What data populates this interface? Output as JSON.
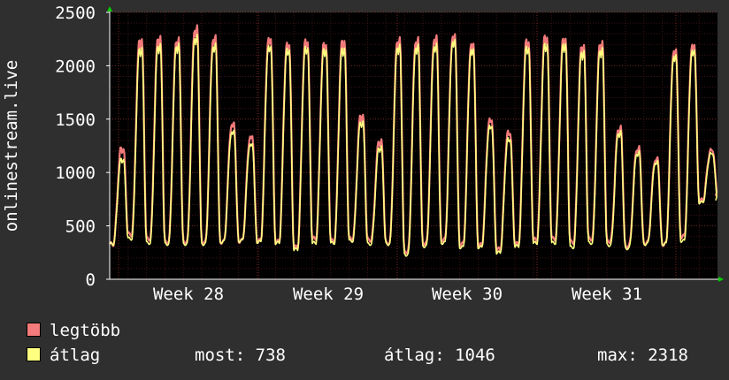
{
  "chart_data": {
    "type": "line",
    "ylabel": "onlinestream.live",
    "ylim": [
      0,
      2500
    ],
    "yticks": [
      0,
      500,
      1000,
      1500,
      2000,
      2500
    ],
    "x_tick_labels": [
      "Week 28",
      "Week 29",
      "Week 30",
      "Week 31"
    ],
    "days": 33,
    "grid": true,
    "background": "#000000",
    "grid_color": "#5a1d1d",
    "series": [
      {
        "name": "legtöbb",
        "color": "#f37b7b",
        "daily_peaks": [
          1230,
          2250,
          2270,
          2250,
          2360,
          2270,
          1460,
          1340,
          2260,
          2210,
          2240,
          2210,
          2240,
          1540,
          1300,
          2250,
          2250,
          2270,
          2290,
          2210,
          1500,
          1380,
          2240,
          2280,
          2260,
          2190,
          2220,
          1420,
          1230,
          1130,
          2150,
          2200,
          1210
        ],
        "daily_troughs": [
          330,
          420,
          380,
          350,
          350,
          350,
          350,
          360,
          360,
          350,
          300,
          380,
          360,
          380,
          370,
          340,
          260,
          340,
          370,
          330,
          320,
          280,
          330,
          370,
          380,
          350,
          380,
          360,
          310,
          340,
          330,
          400,
          740
        ],
        "last": 780
      },
      {
        "name": "átlag",
        "color": "#ffff80",
        "daily_peaks": [
          1130,
          2170,
          2200,
          2200,
          2280,
          2200,
          1390,
          1270,
          2190,
          2160,
          2180,
          2160,
          2170,
          1480,
          1240,
          2190,
          2190,
          2200,
          2240,
          2160,
          1440,
          1320,
          2180,
          2210,
          2210,
          2140,
          2160,
          1380,
          1190,
          1100,
          2100,
          2150,
          1180
        ],
        "daily_troughs": [
          330,
          380,
          340,
          330,
          330,
          330,
          350,
          360,
          350,
          340,
          280,
          340,
          340,
          360,
          330,
          330,
          230,
          310,
          340,
          300,
          300,
          250,
          310,
          340,
          340,
          300,
          340,
          320,
          290,
          330,
          330,
          360,
          720
        ],
        "last": 738
      }
    ]
  },
  "legend": {
    "items": [
      {
        "label": "legtöbb",
        "color": "#f37b7b"
      },
      {
        "label": "átlag",
        "color": "#ffff80"
      }
    ]
  },
  "stats": {
    "now": "most: 738",
    "avg": "átlag: 1046",
    "max": "max: 2318"
  }
}
